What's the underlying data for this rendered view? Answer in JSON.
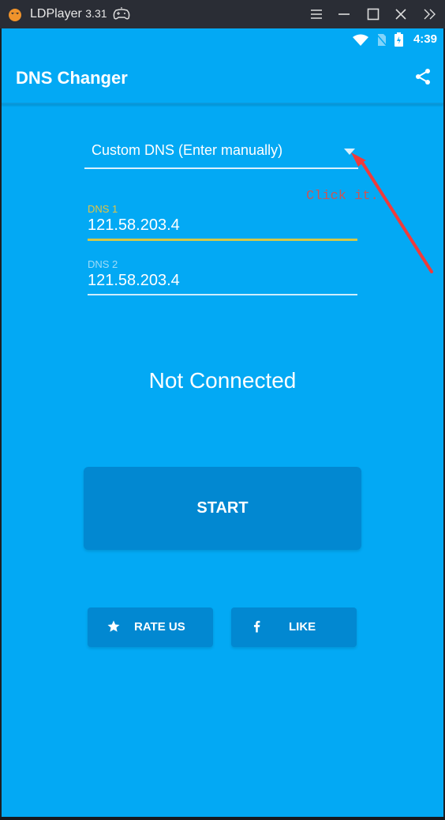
{
  "window": {
    "app_name": "LDPlayer",
    "version": "3.31",
    "controls": [
      "menu-icon",
      "minimize-icon",
      "maximize-icon",
      "close-icon",
      "expand-sidebar-icon"
    ]
  },
  "statusbar": {
    "time": "4:39",
    "icons": [
      "wifi-icon",
      "no-sim-icon",
      "battery-charging-icon"
    ]
  },
  "appbar": {
    "title": "DNS Changer",
    "action_icon": "share-icon"
  },
  "dns_selector": {
    "selected": "Custom DNS (Enter manually)"
  },
  "fields": [
    {
      "label": "DNS 1",
      "value": "121.58.203.4",
      "focused": true
    },
    {
      "label": "DNS 2",
      "value": "121.58.203.4",
      "focused": false
    }
  ],
  "annotation": {
    "text": "Click it.",
    "color": "#e53935"
  },
  "connection_status": "Not Connected",
  "buttons": {
    "start": "START",
    "rate": "RATE US",
    "like": "LIKE"
  },
  "colors": {
    "primary": "#03a9f4",
    "primary_dark": "#0288d1",
    "accent": "#d2c84a",
    "titlebar": "#2a2d35"
  }
}
